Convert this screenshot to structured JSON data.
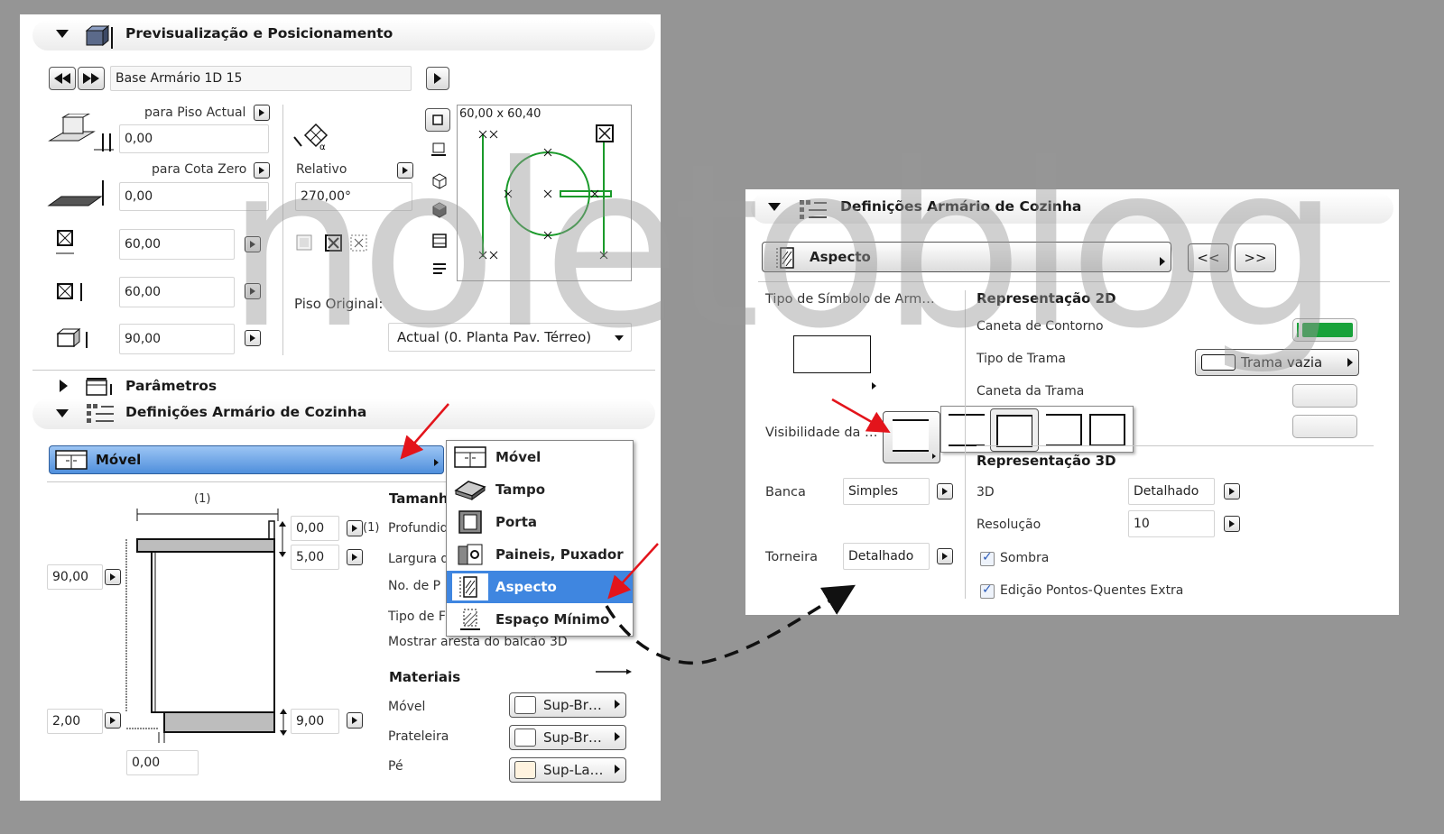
{
  "colors": {
    "background": "#959595",
    "selection": "#3f86e0",
    "accent_green": "#18a23a",
    "arrow": "#e3141b"
  },
  "watermark": "noletoblog",
  "left_panel": {
    "preview_section": {
      "title": "Previsualização e Posicionamento",
      "object_name": "Base Armário 1D 15",
      "para_piso_actual_label": "para Piso Actual",
      "para_piso_actual_value": "0,00",
      "para_cota_zero_label": "para Cota Zero",
      "para_cota_zero_value": "0,00",
      "relativo_label": "Relativo",
      "angle_value": "270,00°",
      "width_value": "60,00",
      "depth_value": "60,00",
      "height_value": "90,00",
      "piso_original_label": "Piso Original:",
      "piso_original_value": "Actual (0. Planta Pav. Térreo)",
      "preview_size_label": "60,00 x 60,40"
    },
    "parametros_section": {
      "title": "Parâmetros"
    },
    "definicoes_section": {
      "title": "Definições Armário de Cozinha",
      "page_selector_label": "Móvel",
      "diagram_label_top": "(1)",
      "diagram_label_side": "(1)",
      "left_value_top": "90,00",
      "left_value_bottom": "2,00",
      "bottom_value": "0,00",
      "top_value_1": "0,00",
      "top_value_2": "5,00",
      "base_value": "9,00",
      "tamanho_heading": "Tamanh",
      "rows": [
        "Profundid",
        "Largura d",
        "No. de P",
        "Tipo de F"
      ],
      "mostrar_aresta_label": "Mostrar aresta do balcão 3D",
      "materiais_heading": "Materiais",
      "materials": [
        {
          "label": "Móvel",
          "value": "Sup-Br…",
          "color": "#ffffff"
        },
        {
          "label": "Prateleira",
          "value": "Sup-Br…",
          "color": "#ffffff"
        },
        {
          "label": "Pé",
          "value": "Sup-La…",
          "color": "#fff3df"
        }
      ]
    },
    "dropdown_menu": {
      "items": [
        {
          "label": "Móvel",
          "icon": "cabinet-icon"
        },
        {
          "label": "Tampo",
          "icon": "worktop-icon"
        },
        {
          "label": "Porta",
          "icon": "door-icon"
        },
        {
          "label": "Paineis, Puxador",
          "icon": "handle-icon"
        },
        {
          "label": "Aspecto",
          "icon": "aspect-icon"
        },
        {
          "label": "Espaço Mínimo",
          "icon": "min-space-icon"
        }
      ],
      "selected_index": 4
    }
  },
  "right_panel": {
    "title": "Definições Armário de Cozinha",
    "page_selector_label": "Aspecto",
    "prev_button": "<<",
    "next_button": ">>",
    "tipo_simbolo_label": "Tipo de Símbolo de Arm…",
    "visibilidade_label": "Visibilidade da …",
    "banca_label": "Banca",
    "banca_value": "Simples",
    "torneira_label": "Torneira",
    "torneira_value": "Detalhado",
    "rep2d_heading": "Representação 2D",
    "caneta_contorno_label": "Caneta de Contorno",
    "tipo_trama_label": "Tipo de Trama",
    "tipo_trama_value": "Trama vazia",
    "caneta_trama_label": "Caneta da Trama",
    "rep3d_heading": "Representação 3D",
    "label_3d": "3D",
    "value_3d": "Detalhado",
    "resolucao_label": "Resolução",
    "resolucao_value": "10",
    "sombra_label": "Sombra",
    "sombra_checked": true,
    "edicao_label": "Edição Pontos-Quentes Extra",
    "edicao_checked": true
  }
}
